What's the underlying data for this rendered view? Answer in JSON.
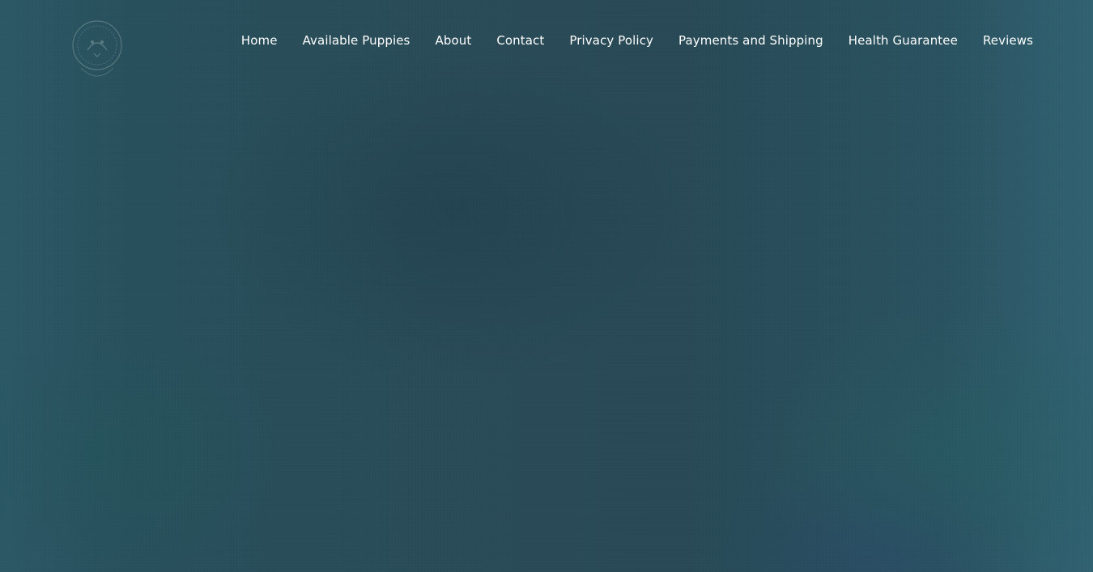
{
  "nav": {
    "items": [
      {
        "label": "Home"
      },
      {
        "label": "Available Puppies"
      },
      {
        "label": "About"
      },
      {
        "label": "Contact"
      },
      {
        "label": "Privacy Policy"
      },
      {
        "label": "Payments and Shipping"
      },
      {
        "label": "Health Guarantee"
      },
      {
        "label": "Reviews"
      }
    ]
  },
  "logo": {
    "icon": "circular-seal-logo-icon",
    "color": "#8fa7a6"
  },
  "theme": {
    "background": "#2a4e5a",
    "nav_text": "#ffffff"
  }
}
